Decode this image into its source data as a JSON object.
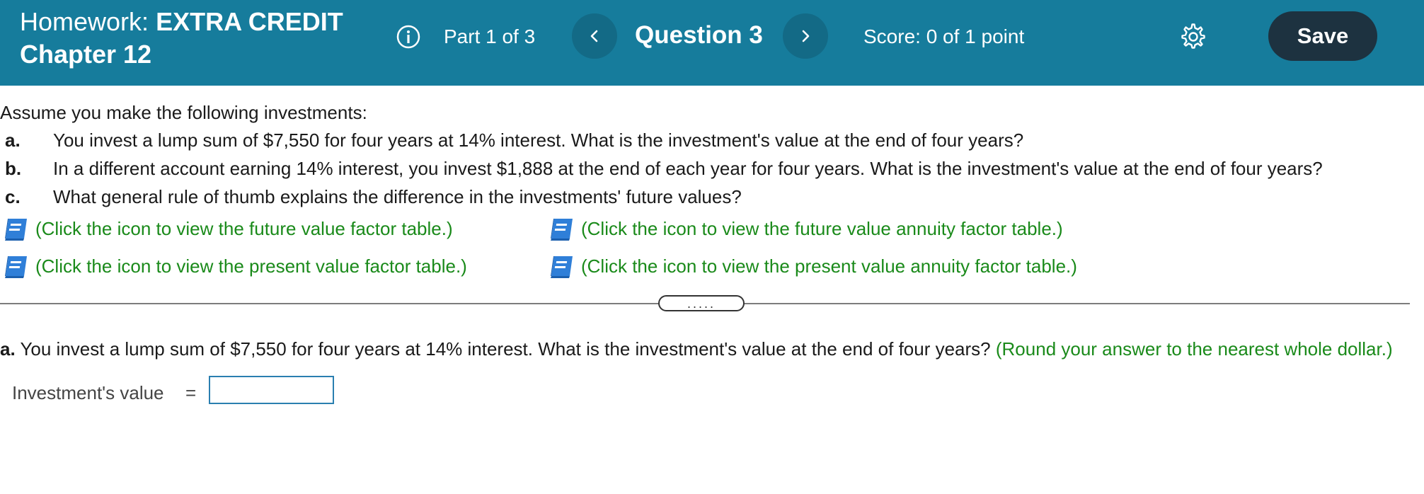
{
  "header": {
    "homework_prefix": "Homework:",
    "homework_title": "EXTRA CREDIT",
    "chapter": "Chapter 12",
    "part_label": "Part 1 of 3",
    "question_label": "Question 3",
    "score_label": "Score: 0 of 1 point",
    "save_label": "Save",
    "icons": {
      "info": "info-icon",
      "prev": "chevron-left-icon",
      "next": "chevron-right-icon",
      "settings": "gear-icon"
    },
    "colors": {
      "background": "#167c9c",
      "nav_button": "#136a86",
      "save_button": "#1d3240"
    }
  },
  "question": {
    "intro": "Assume you make the following investments:",
    "items": [
      {
        "letter": "a.",
        "text": "You invest a lump sum of $7,550 for four years at 14% interest. What is the investment's value at the end of four years?"
      },
      {
        "letter": "b.",
        "text": "In a different account earning 14% interest, you invest $1,888 at the end of each year for four years. What is the investment's value at the end of four years?"
      },
      {
        "letter": "c.",
        "text": "What general rule of thumb explains the difference in the investments' future values?"
      }
    ],
    "table_links": [
      {
        "text": "(Click the icon to view the future value factor table.)",
        "icon": "book-icon"
      },
      {
        "text": "(Click the icon to view the future value annuity factor table.)",
        "icon": "book-icon"
      },
      {
        "text": "(Click the icon to view the present value factor table.)",
        "icon": "book-icon"
      },
      {
        "text": "(Click the icon to view the present value annuity factor table.)",
        "icon": "book-icon"
      }
    ],
    "link_color": "#1a8a1a"
  },
  "divider": {
    "handle_label": "....."
  },
  "part_a": {
    "prefix": "a.",
    "question": "You invest a lump sum of $7,550 for four years at 14% interest. What is the investment's value at the end of four years?",
    "hint": "(Round your answer to the nearest whole dollar.)",
    "answer_label": "Investment's value",
    "equals": "=",
    "answer_value": ""
  }
}
